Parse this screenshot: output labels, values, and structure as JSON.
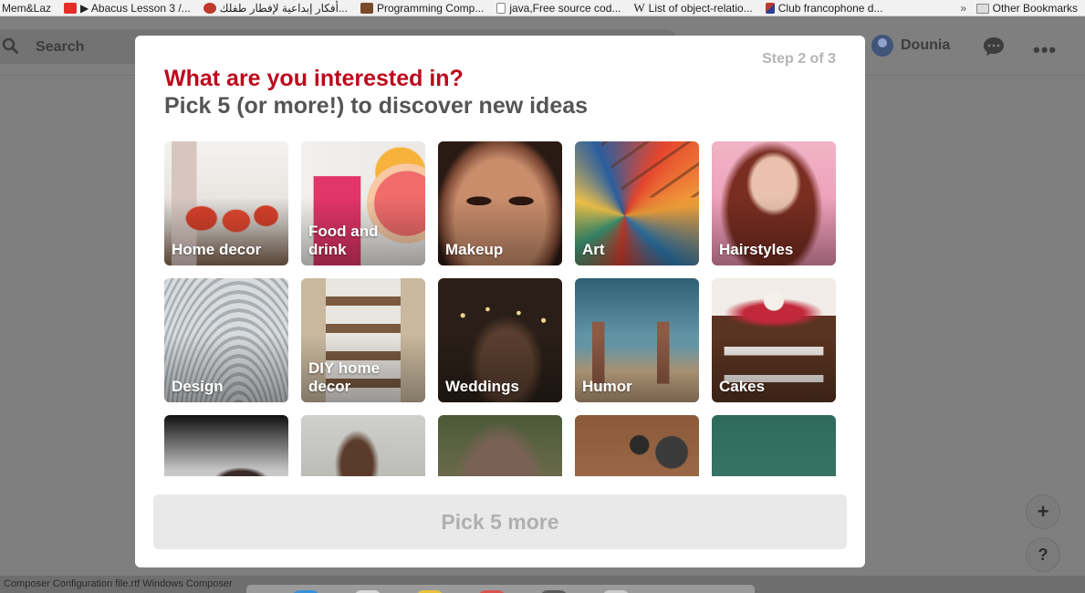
{
  "bookmarks": {
    "items": [
      {
        "label": "Mem&Laz",
        "color": ""
      },
      {
        "label": "▶ Abacus Lesson 3 /...",
        "color": "#e52d27"
      },
      {
        "label": "أفكار إبداعية لإفطار طفلك...",
        "color": "#c0392b"
      },
      {
        "label": "Programming Comp...",
        "color": "#7a4b2a"
      },
      {
        "label": "java,Free source cod...",
        "color": "#ffffff"
      },
      {
        "label": "List of object-relatio...",
        "color": "#ffffff"
      },
      {
        "label": "Club francophone d...",
        "color": "#c0392b"
      }
    ],
    "overflow": "»",
    "other": "Other Bookmarks"
  },
  "header": {
    "search_label": "Search",
    "user_name": "Dounia",
    "more": "•••"
  },
  "floating": {
    "plus": "+",
    "help": "?"
  },
  "status_text": "Composer Configuration file.rtf Windows Composer",
  "modal": {
    "step": "Step 2 of 3",
    "title": "What are you interested in?",
    "subtitle": "Pick 5 (or more!) to discover new ideas",
    "button": "Pick 5 more",
    "tiles": [
      {
        "label": "Home decor"
      },
      {
        "label": "Food and drink"
      },
      {
        "label": "Makeup"
      },
      {
        "label": "Art"
      },
      {
        "label": "Hairstyles"
      },
      {
        "label": "Design"
      },
      {
        "label": "DIY home decor"
      },
      {
        "label": "Weddings"
      },
      {
        "label": "Humor"
      },
      {
        "label": "Cakes"
      },
      {
        "label": ""
      },
      {
        "label": ""
      },
      {
        "label": ""
      },
      {
        "label": ""
      },
      {
        "label": ""
      }
    ]
  },
  "colors": {
    "accent": "#bd081c",
    "overlay": "#7f7f7f"
  }
}
